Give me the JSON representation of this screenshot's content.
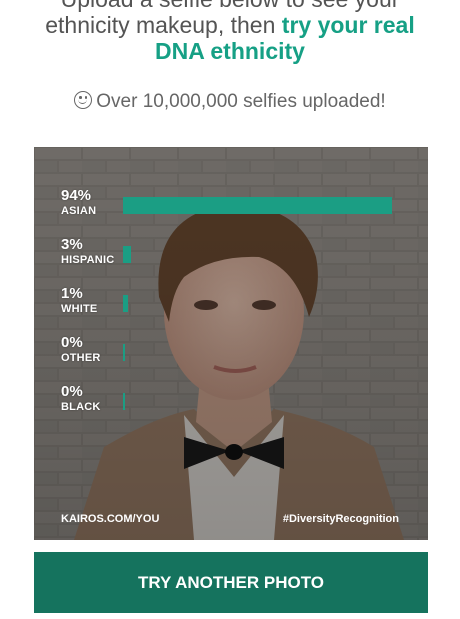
{
  "intro": {
    "line1": "Upload a selfie below to see your",
    "line2_plain": "ethnicity makeup, then ",
    "line2_link": "try your real",
    "line3_link": "DNA ethnicity"
  },
  "tagline": {
    "icon": "smiley-icon",
    "text": "Over 10,000,000 selfies uploaded!"
  },
  "results": [
    {
      "percent": "94%",
      "label": "ASIAN",
      "value": 94
    },
    {
      "percent": "3%",
      "label": "HISPANIC",
      "value": 3
    },
    {
      "percent": "1%",
      "label": "WHITE",
      "value": 1
    },
    {
      "percent": "0%",
      "label": "OTHER",
      "value": 0
    },
    {
      "percent": "0%",
      "label": "BLACK",
      "value": 0
    }
  ],
  "photo_footer": {
    "left": "KAIROS.COM/YOU",
    "right": "#DiversityRecognition"
  },
  "button": {
    "label": "TRY ANOTHER PHOTO"
  },
  "colors": {
    "accent": "#16a085",
    "bar": "#1b9e84",
    "button": "#15735e"
  }
}
